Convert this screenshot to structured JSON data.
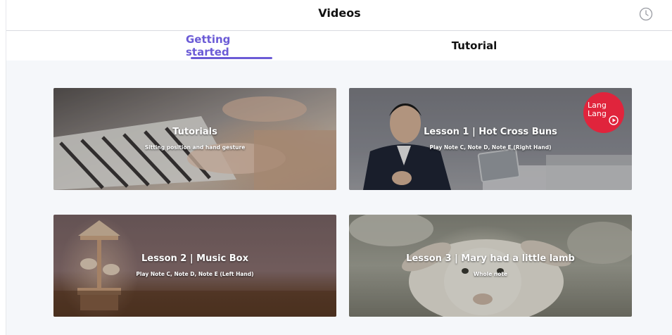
{
  "header": {
    "title": "Videos",
    "history_icon": "clock-history-icon"
  },
  "tabs": [
    {
      "label": "Getting started",
      "active": true
    },
    {
      "label": "Tutorial",
      "active": false
    }
  ],
  "accent_color": "#6b5bd6",
  "cards": [
    {
      "title": "Tutorials",
      "subtitle": "Sitting position and hand gesture"
    },
    {
      "title": "Lesson 1 | Hot Cross Buns",
      "subtitle": "Play Note C, Note D, Note E (Right Hand)",
      "badge": "Lang Lang"
    },
    {
      "title": "Lesson 2 | Music Box",
      "subtitle": "Play Note C, Note D, Note E (Left Hand)"
    },
    {
      "title": "Lesson 3 | Mary had a little lamb",
      "subtitle": "Whole note"
    }
  ]
}
